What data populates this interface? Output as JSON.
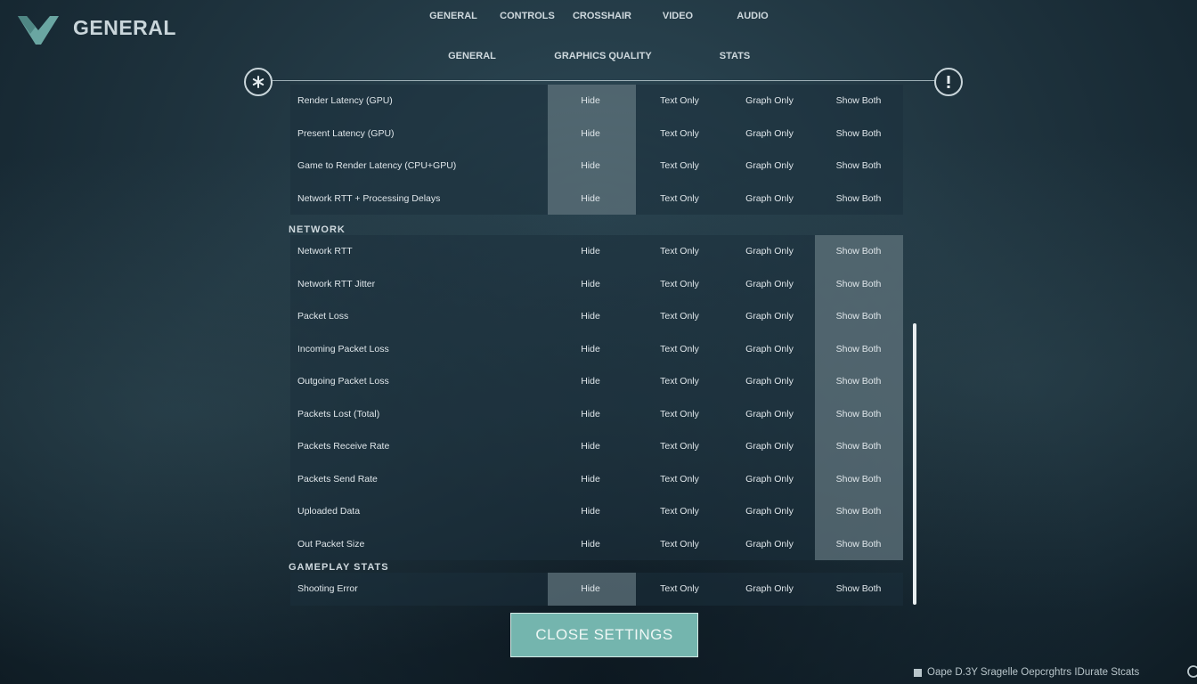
{
  "header": {
    "title": "GENERAL"
  },
  "main_tabs": [
    {
      "label": "GENERAL"
    },
    {
      "label": "CONTROLS"
    },
    {
      "label": "CROSSHAIR"
    },
    {
      "label": "VIDEO"
    },
    {
      "label": "AUDIO"
    }
  ],
  "sub_tabs": [
    {
      "label": "GENERAL"
    },
    {
      "label": "GRAPHICS QUALITY"
    },
    {
      "label": "STATS"
    }
  ],
  "left_icon": "asterisk-icon",
  "right_icon": "alert-icon",
  "options": [
    "Hide",
    "Text Only",
    "Graph Only",
    "Show Both"
  ],
  "sections": [
    {
      "title": "",
      "rows": [
        {
          "label": "Render Latency (GPU)",
          "selected": "Hide"
        },
        {
          "label": "Present Latency (GPU)",
          "selected": "Hide"
        },
        {
          "label": "Game to Render Latency (CPU+GPU)",
          "selected": "Hide"
        },
        {
          "label": "Network RTT + Processing Delays",
          "selected": "Hide"
        }
      ]
    },
    {
      "title": "NETWORK",
      "rows": [
        {
          "label": "Network RTT",
          "selected": "Show Both"
        },
        {
          "label": "Network RTT Jitter",
          "selected": "Show Both"
        },
        {
          "label": "Packet Loss",
          "selected": "Show Both"
        },
        {
          "label": "Incoming Packet Loss",
          "selected": "Show Both"
        },
        {
          "label": "Outgoing Packet Loss",
          "selected": "Show Both"
        },
        {
          "label": "Packets Lost (Total)",
          "selected": "Show Both"
        },
        {
          "label": "Packets Receive Rate",
          "selected": "Show Both"
        },
        {
          "label": "Packets Send Rate",
          "selected": "Show Both"
        },
        {
          "label": "Uploaded Data",
          "selected": "Show Both"
        },
        {
          "label": "Out Packet Size",
          "selected": "Show Both"
        }
      ]
    },
    {
      "title": "GAMEPLAY STATS",
      "rows": [
        {
          "label": "Shooting Error",
          "selected": "Hide"
        }
      ]
    }
  ],
  "close_button": {
    "label": "CLOSE SETTINGS"
  },
  "footer": {
    "text": "Oape D.3Y Sragelle Oepcrghtrs IDurate Stcats"
  },
  "colors": {
    "accent": "#74b5ae",
    "selected_cell": "#7a8c94"
  }
}
